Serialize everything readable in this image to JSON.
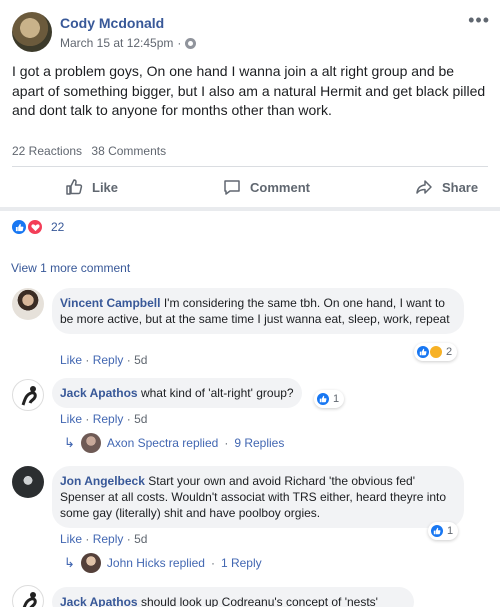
{
  "post": {
    "author": "Cody Mcdonald",
    "date": "March 15 at 12:45pm",
    "separator": "·",
    "text": "I got a problem goys, On one hand I wanna join a alt right group and be apart of something bigger, but I also am a natural Hermit and get black pilled and dont talk to anyone for months other than work.",
    "reactions_label": "22 Reactions",
    "comments_label": "38 Comments"
  },
  "actions": {
    "like": "Like",
    "comment": "Comment",
    "share": "Share"
  },
  "reaction_bar": {
    "count": "22"
  },
  "view_more": "View 1 more comment",
  "comments": [
    {
      "name": "Vincent Campbell",
      "text": "I'm considering the same tbh. On one hand, I want to be more active, but at the same time I just wanna eat, sleep, work, repeat",
      "like": "Like",
      "reply": "Reply",
      "time": "5d",
      "reactions": "2"
    },
    {
      "name": "Jack Apathos",
      "text": "what kind of 'alt-right' group?",
      "like": "Like",
      "reply": "Reply",
      "time": "5d",
      "reactions": "1",
      "replies": {
        "name": "Axon Spectra replied",
        "count": "9 Replies"
      }
    },
    {
      "name": "Jon Angelbeck",
      "text": "Start your own and avoid Richard 'the obvious fed' Spenser at all costs. Wouldn't associat with TRS either, heard theyre into some gay (literally) shit and have poolboy orgies.",
      "like": "Like",
      "reply": "Reply",
      "time": "5d",
      "reactions": "1",
      "replies": {
        "name": "John Hicks replied",
        "count": "1 Reply"
      }
    },
    {
      "name": "Jack Apathos",
      "text": "should look up Codreanu's concept of 'nests'"
    }
  ],
  "colors": {
    "link": "#385898",
    "like_blue": "#1877f2",
    "love_red": "#f33e58",
    "bubble": "#f2f3f5"
  }
}
